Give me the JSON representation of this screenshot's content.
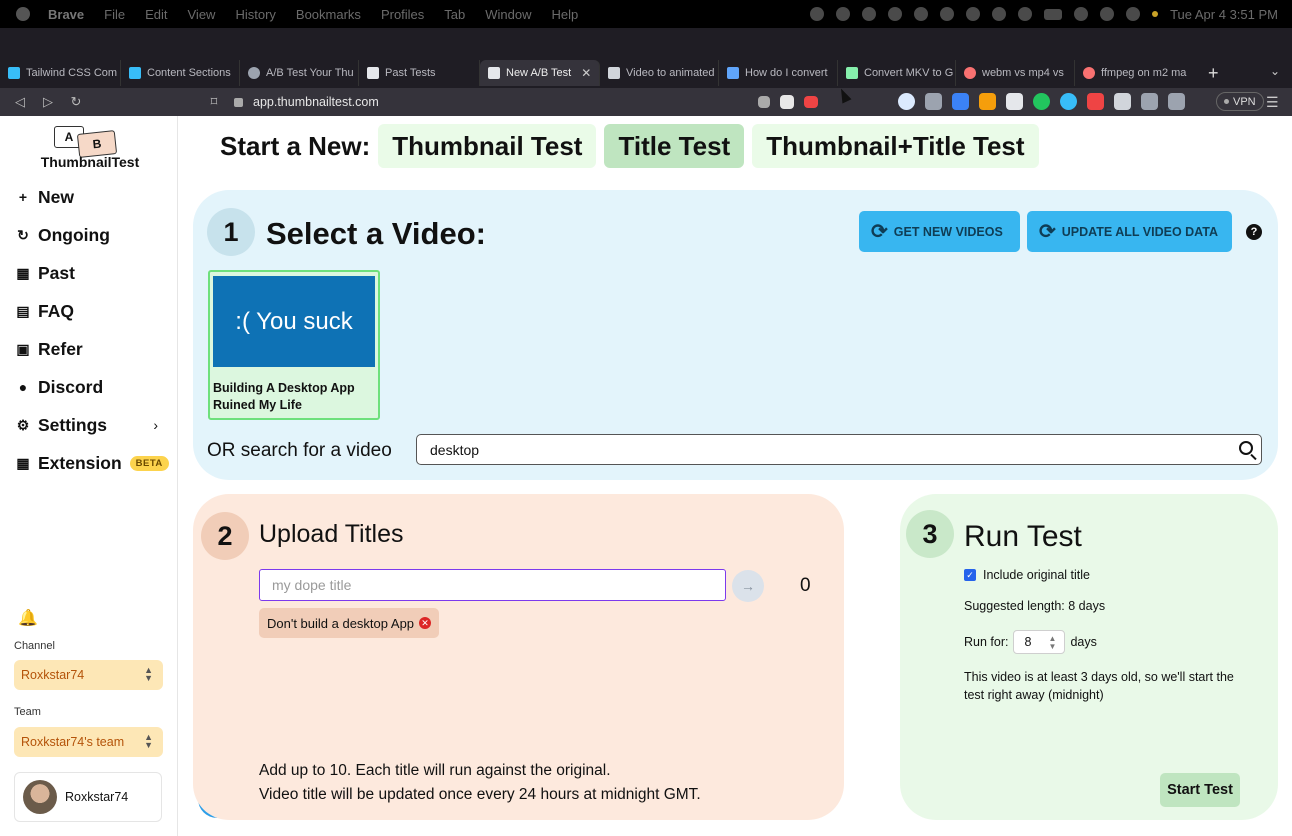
{
  "menubar": {
    "app_name": "Brave",
    "items": [
      "File",
      "Edit",
      "View",
      "History",
      "Bookmarks",
      "Profiles",
      "Tab",
      "Window",
      "Help"
    ],
    "clock": "Tue Apr 4  3:51 PM"
  },
  "tabs": [
    {
      "label": "Tailwind CSS Com",
      "color": "#38bdf8"
    },
    {
      "label": "Content Sections",
      "color": "#38bdf8"
    },
    {
      "label": "A/B Test Your Thu",
      "color": "#9ca3af"
    },
    {
      "label": "Past Tests",
      "color": "#e5e7eb"
    },
    {
      "label": "New A/B Test",
      "color": "#e5e7eb",
      "active": true
    },
    {
      "label": "Video to animated",
      "color": "#d1d5db"
    },
    {
      "label": "How do I convert",
      "color": "#60a5fa"
    },
    {
      "label": "Convert MKV to G",
      "color": "#86efac"
    },
    {
      "label": "webm vs mp4 vs",
      "color": "#f87171"
    },
    {
      "label": "ffmpeg on m2 ma",
      "color": "#f87171"
    }
  ],
  "address_bar": {
    "url": "app.thumbnailtest.com",
    "vpn_label": "VPN"
  },
  "sidebar": {
    "logo_a": "A",
    "logo_b": "B",
    "brand": "ThumbnailTest",
    "nav": [
      {
        "id": "new",
        "label": "New",
        "icon": "plus-icon"
      },
      {
        "id": "ongoing",
        "label": "Ongoing",
        "icon": "refresh-icon"
      },
      {
        "id": "past",
        "label": "Past",
        "icon": "grid-icon"
      },
      {
        "id": "faq",
        "label": "FAQ",
        "icon": "document-icon"
      },
      {
        "id": "refer",
        "label": "Refer",
        "icon": "ticket-icon"
      },
      {
        "id": "discord",
        "label": "Discord",
        "icon": "chat-icon"
      },
      {
        "id": "settings",
        "label": "Settings",
        "icon": "gear-icon"
      },
      {
        "id": "extension",
        "label": "Extension",
        "icon": "grid-icon",
        "badge": "BETA"
      }
    ],
    "channel_label": "Channel",
    "channel_value": "Roxkstar74",
    "team_label": "Team",
    "team_value": "Roxkstar74's team",
    "user_name": "Roxkstar74"
  },
  "start_row": {
    "label": "Start a New:",
    "options": [
      "Thumbnail Test",
      "Title Test",
      "Thumbnail+Title Test"
    ],
    "selected": "Title Test"
  },
  "step1": {
    "number": "1",
    "title": "Select a Video:",
    "get_new_videos": "GET NEW VIDEOS",
    "update_all": "UPDATE ALL VIDEO DATA",
    "help": "?",
    "video": {
      "thumb_text": ":(  You suck",
      "title": "Building A Desktop App Ruined My Life"
    },
    "search_label": "OR search for a video",
    "search_value": "desktop"
  },
  "step2": {
    "number": "2",
    "title": "Upload Titles",
    "input_placeholder": "my dope title",
    "count": "0",
    "chip": "Don't build a desktop App",
    "note1": "Add up to 10. Each title will run against the original.",
    "note2": "Video title will be updated once every 24 hours at midnight GMT."
  },
  "step3": {
    "number": "3",
    "title": "Run Test",
    "include_original": "Include original title",
    "suggested": "Suggested length: 8 days",
    "run_for_label": "Run for:",
    "run_for_value": "8",
    "run_for_unit": "days",
    "age_note": "This video is at least 3 days old, so we'll start the test right away (midnight)",
    "start_button": "Start Test"
  }
}
